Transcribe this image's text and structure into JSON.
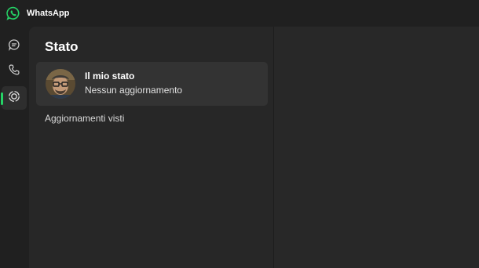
{
  "app": {
    "title": "WhatsApp",
    "logo_icon": "whatsapp-logo-icon",
    "accent_color": "#25d366"
  },
  "rail": {
    "items": [
      {
        "icon": "chats-icon",
        "active": false
      },
      {
        "icon": "calls-icon",
        "active": false
      },
      {
        "icon": "status-icon",
        "active": true
      }
    ]
  },
  "status_panel": {
    "title": "Stato",
    "my_status": {
      "name": "Il mio stato",
      "subtitle": "Nessun aggiornamento"
    },
    "viewed_section_label": "Aggiornamenti visti"
  }
}
